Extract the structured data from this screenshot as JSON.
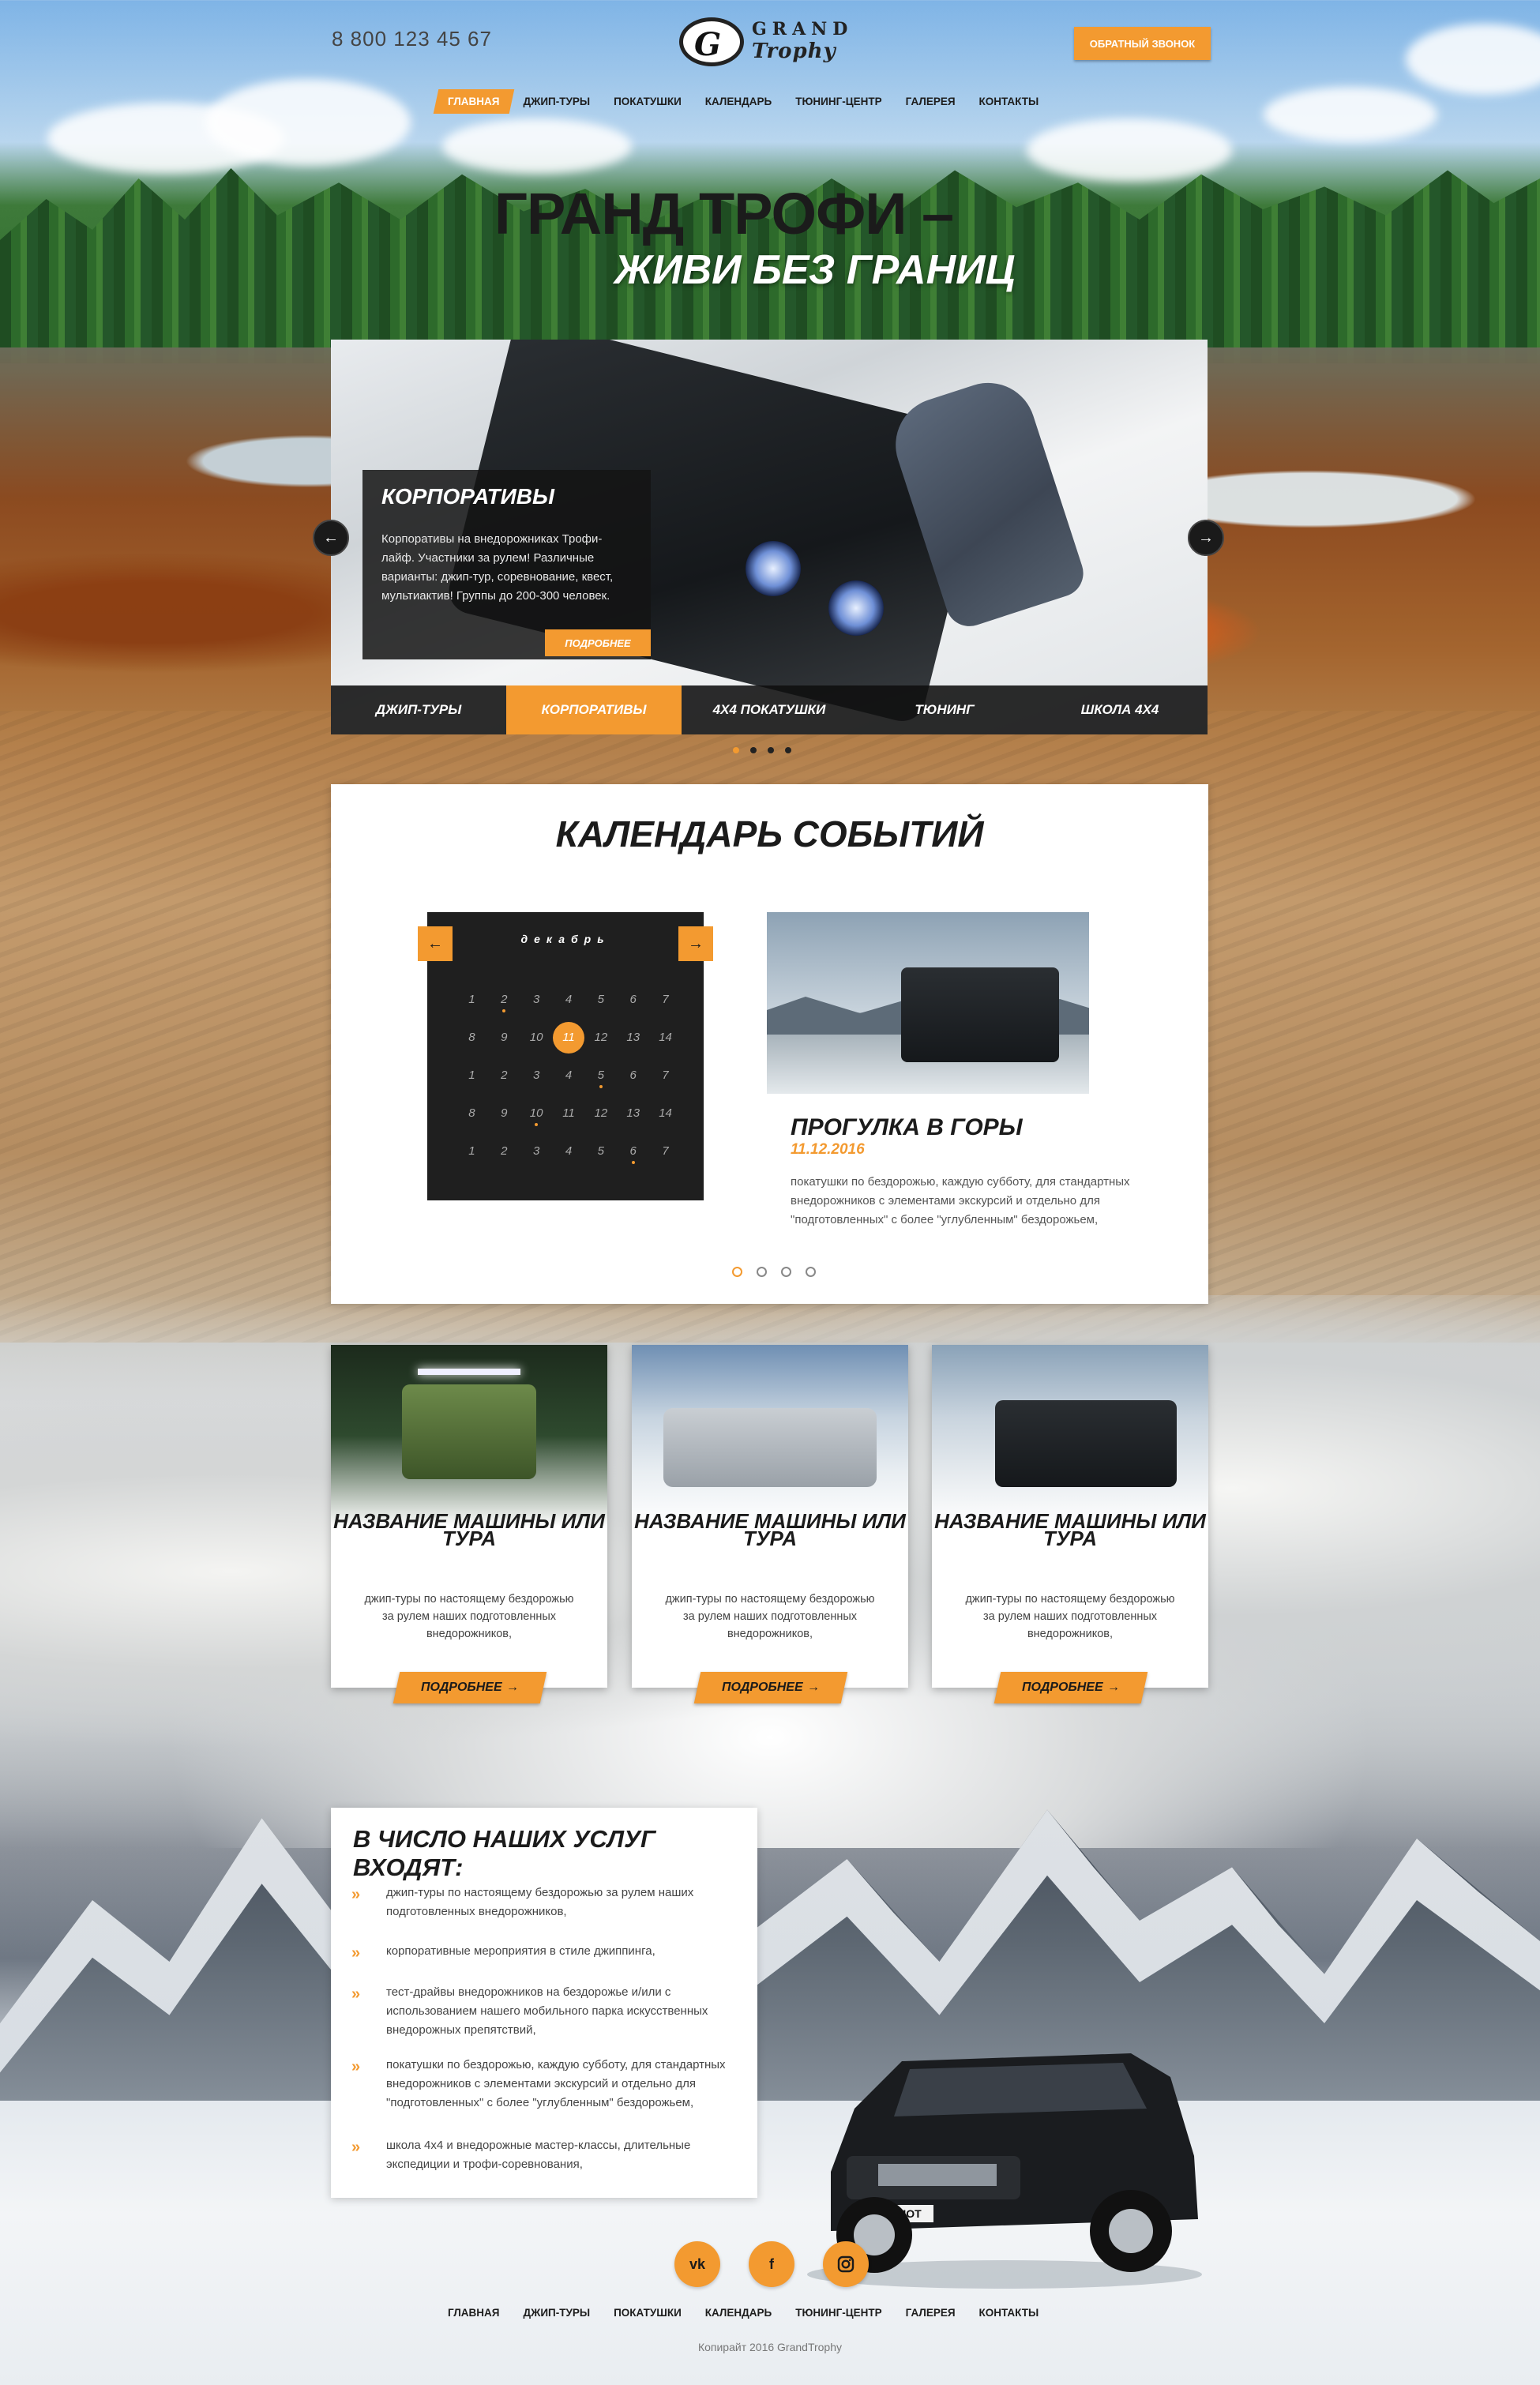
{
  "header": {
    "phone": "8 800 123 45 67",
    "logo_line1": "GRAND",
    "logo_line2": "Trophy",
    "logo_mark": "G",
    "callback_label": "ОБРАТНЫЙ ЗВОНОК"
  },
  "nav": {
    "items": [
      "ГЛАВНАЯ",
      "ДЖИП-ТУРЫ",
      "ПОКАТУШКИ",
      "КАЛЕНДАРЬ",
      "ТЮНИНГ-ЦЕНТР",
      "ГАЛЕРЕЯ",
      "КОНТАКТЫ"
    ],
    "active": "ГЛАВНАЯ"
  },
  "hero": {
    "title": "ГРАНД ТРОФИ –",
    "subtitle": "ЖИВИ БЕЗ ГРАНИЦ"
  },
  "slider": {
    "title": "КОРПОРАТИВЫ",
    "text": "Корпоративы на внедорожниках Трофи-лайф. Участники за рулем! Различные варианты: джип-тур, соревнование, квест, мультиактив! Группы до 200-300 человек.",
    "more_label": "ПОДРОБНЕЕ",
    "prev_icon": "←",
    "next_icon": "→",
    "tabs": [
      "ДЖИП-ТУРЫ",
      "КОРПОРАТИВЫ",
      "4Х4 ПОКАТУШКИ",
      "ТЮНИНГ",
      "ШКОЛА 4Х4"
    ],
    "active_tab": 1
  },
  "calendar": {
    "title": "КАЛЕНДАРЬ СОБЫТИЙ",
    "month": "декабрь",
    "prev_icon": "←",
    "next_icon": "→",
    "days": [
      "1",
      "2",
      "3",
      "4",
      "5",
      "6",
      "7",
      "8",
      "9",
      "10",
      "11",
      "12",
      "13",
      "14",
      "1",
      "2",
      "3",
      "4",
      "5",
      "6",
      "7",
      "8",
      "9",
      "10",
      "11",
      "12",
      "13",
      "14",
      "1",
      "2",
      "3",
      "4",
      "5",
      "6",
      "7"
    ],
    "today_index": 10,
    "event_indices": [
      1,
      18,
      23,
      33
    ],
    "event": {
      "title": "ПРОГУЛКА В ГОРЫ",
      "date": "11.12.2016",
      "text": "покатушки по бездорожью, каждую субботу, для стандартных внедорожников с элементами экскурсий и отдельно для \"подготовленных\" с более \"углубленным\" бездорожьем,"
    }
  },
  "cards": [
    {
      "title": "НАЗВАНИЕ МАШИНЫ ИЛИ ТУРА",
      "text": "джип-туры по настоящему бездорожью за рулем наших подготовленных внедорожников,",
      "button": "ПОДРОБНЕЕ"
    },
    {
      "title": "НАЗВАНИЕ МАШИНЫ ИЛИ ТУРА",
      "text": "джип-туры по настоящему бездорожью за рулем наших подготовленных внедорожников,",
      "button": "ПОДРОБНЕЕ"
    },
    {
      "title": "НАЗВАНИЕ МАШИНЫ ИЛИ ТУРА",
      "text": "джип-туры по настоящему бездорожью за рулем наших подготовленных внедорожников,",
      "button": "ПОДРОБНЕЕ"
    }
  ],
  "services": {
    "title": "В ЧИСЛО НАШИХ УСЛУГ ВХОДЯТ:",
    "items": [
      "джип-туры по настоящему бездорожью за рулем наших подготовленных внедорожников,",
      "корпоративные мероприятия в стиле джиппинга,",
      "тест-драйвы внедорожников на бездорожье и/или с использованием нашего мобильного парка искусственных внедорожных препятствий,",
      "покатушки по бездорожью, каждую субботу, для стандартных внедорожников с элементами экскурсий и отдельно для \"подготовленных\" с более \"углубленным\" бездорожьем,",
      "школа 4х4 и внедорожные мастер-классы, длительные экспедиции и трофи-соревнования,"
    ]
  },
  "car_plate": "PATRIOT",
  "social": [
    "vk",
    "f",
    "instagram"
  ],
  "footer": {
    "nav": [
      "ГЛАВНАЯ",
      "ДЖИП-ТУРЫ",
      "ПОКАТУШКИ",
      "КАЛЕНДАРЬ",
      "ТЮНИНГ-ЦЕНТР",
      "ГАЛЕРЕЯ",
      "КОНТАКТЫ"
    ],
    "copyright": "Копирайт 2016 GrandTrophy"
  },
  "colors": {
    "accent": "#f39a30",
    "dark": "#1b1b1b"
  }
}
